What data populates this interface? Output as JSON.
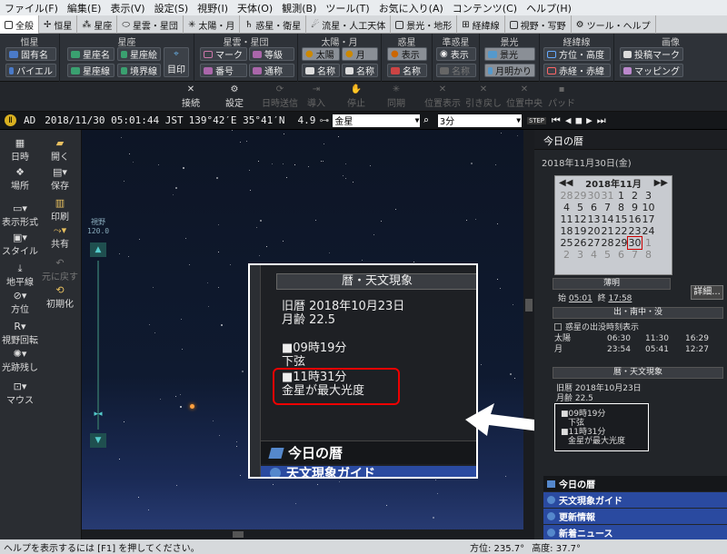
{
  "menubar": {
    "items": [
      "ファイル(F)",
      "編集(E)",
      "表示(V)",
      "設定(S)",
      "視野(I)",
      "天体(O)",
      "観測(B)",
      "ツール(T)",
      "お気に入り(A)",
      "コンテンツ(C)",
      "ヘルプ(H)"
    ]
  },
  "tabs": [
    "全般",
    "恒星",
    "星座",
    "星雲・星団",
    "太陽・月",
    "惑星・衛星",
    "流星・人工天体",
    "景光・地形",
    "経緯線",
    "視野・写野",
    "ツール・ヘルプ"
  ],
  "ribbon": {
    "groups": {
      "stars": "恒星",
      "constellations": "星座",
      "nebulae": "星雲・星団",
      "sunmoon": "太陽・月",
      "planets": "惑星",
      "minor": "準惑星",
      "scene": "景光",
      "gridlines": "経緯線",
      "image": "画像"
    },
    "stars": {
      "propername": "固有名",
      "bayer": "バイエル"
    },
    "const": {
      "name": "星座名",
      "line": "星座線",
      "picture": "星座絵",
      "boundary": "境界線",
      "mark": "目印"
    },
    "nebulae": {
      "mark": "マーク",
      "number": "番号",
      "magnitude": "等級",
      "common": "通称"
    },
    "sunmoon": {
      "sun": "太陽",
      "moon": "月",
      "name1": "名称",
      "name2": "名称"
    },
    "planets": {
      "show": "表示",
      "name": "名称"
    },
    "minor": {
      "show": "表示",
      "name": "名称"
    },
    "scene": {
      "scenery": "景光",
      "moonlight": "月明かり"
    },
    "grid": {
      "azalt": "方位・高度",
      "radec": "赤経・赤緯"
    },
    "image": {
      "post": "投稿マーク",
      "mapping": "マッピング"
    }
  },
  "toolbar2": {
    "connect": "接続",
    "settings": "設定",
    "time_send": "日時送信",
    "intro": "導入",
    "stop": "停止",
    "sync": "同期",
    "pos_show": "位置表示",
    "pull": "引き戻し",
    "center": "位置中央",
    "pad": "パッド"
  },
  "datebar": {
    "era": "AD",
    "datetime": "2018/11/30 05:01:44 JST",
    "location": "139°42′E 35°41′N",
    "magnitude": "4.9",
    "object": "金星",
    "interval": "3分",
    "step": "STEP"
  },
  "sidebar": {
    "datetime": "日時",
    "place": "場所",
    "display": "表示形式",
    "style": "スタイル",
    "horizon": "地平線",
    "direction": "方位",
    "field_rotate": "視野回転",
    "trail": "光跡残し",
    "mouse": "マウス",
    "open": "開く",
    "save": "保存",
    "print": "印刷",
    "share": "共有",
    "undo": "元に戻す",
    "init": "初期化",
    "fov": "視野",
    "fov_value": "120.0"
  },
  "panel": {
    "title": "今日の暦",
    "date": "2018年11月30日(金)",
    "cal_month": "2018年11月",
    "cal_rows": [
      [
        "28",
        "29",
        "30",
        "31",
        "1",
        "2",
        "3"
      ],
      [
        "4",
        "5",
        "6",
        "7",
        "8",
        "9",
        "10"
      ],
      [
        "11",
        "12",
        "13",
        "14",
        "15",
        "16",
        "17"
      ],
      [
        "18",
        "19",
        "20",
        "21",
        "22",
        "23",
        "24"
      ],
      [
        "25",
        "26",
        "27",
        "28",
        "29",
        "30",
        "1"
      ],
      [
        "2",
        "3",
        "4",
        "5",
        "6",
        "7",
        "8"
      ]
    ],
    "moon_phase": "薄明",
    "moon_start_label": "始",
    "moon_start": "05:01",
    "moon_end_label": "終",
    "moon_end": "17:58",
    "detail_btn": "詳細...",
    "rise_title": "出・南中・没",
    "rise_check": "惑星の出没時刻表示",
    "rise_rows": [
      {
        "name": "太陽",
        "rise": "06:30",
        "transit": "11:30",
        "set": "16:29"
      },
      {
        "name": "月",
        "rise": "23:54",
        "transit": "05:41",
        "set": "12:27"
      }
    ],
    "events_title": "暦・天文現象",
    "lunar": "旧暦 2018年10月23日",
    "age": "月齢 22.5",
    "ev1_time": "■09時19分",
    "ev1": "下弦",
    "ev2_time": "■11時31分",
    "ev2": "金星が最大光度",
    "sec1": "今日の暦",
    "sec2": "天文現象ガイド",
    "sec3": "更新情報",
    "sec4": "新着ニュース"
  },
  "zoom": {
    "header": "暦・天文現象",
    "lunar": "旧暦 2018年10月23日",
    "age": "月齢 22.5",
    "ev1_time": "■09時19分",
    "ev1": "下弦",
    "ev2_time": "■11時31分",
    "ev2": "金星が最大光度",
    "footer": "今日の暦",
    "footer2": "天文現象ガイド"
  },
  "callout": {
    "ev1_time": "■09時19分",
    "ev1": "下弦",
    "ev2_time": "■11時31分",
    "ev2": "金星が最大光度"
  },
  "status": {
    "hint": "ヘルプを表示するには [F1] を押してください。",
    "azimuth": "方位: 235.7°",
    "altitude": "高度: 37.7°"
  },
  "colors": {
    "accent_red": "#e00000",
    "panel_bg": "#222529",
    "sky_top": "#0d1525",
    "sky_bottom": "#2a3e78"
  }
}
